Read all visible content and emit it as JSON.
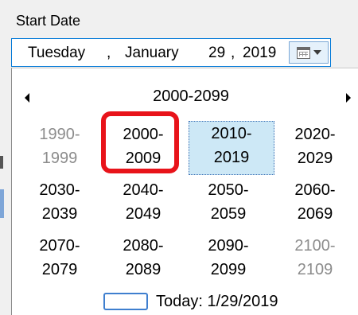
{
  "field": {
    "label": "Start Date",
    "weekday": "Tuesday",
    "separator1": ",",
    "month": "January",
    "day": "29",
    "separator2": ",",
    "year": "2019",
    "button_icon": "calendar-dropdown-icon"
  },
  "calendar": {
    "view": "century",
    "header": "2000-2099",
    "prev_icon": "triangle-left-icon",
    "next_icon": "triangle-right-icon",
    "rows": [
      [
        {
          "start": "1990-",
          "end": "1999",
          "out_of_range": true
        },
        {
          "start": "2000-",
          "end": "2009",
          "out_of_range": false
        },
        {
          "start": "2010-",
          "end": "2019",
          "out_of_range": false,
          "selected": true
        },
        {
          "start": "2020-",
          "end": "2029",
          "out_of_range": false
        }
      ],
      [
        {
          "start": "2030-",
          "end": "2039",
          "out_of_range": false
        },
        {
          "start": "2040-",
          "end": "2049",
          "out_of_range": false
        },
        {
          "start": "2050-",
          "end": "2059",
          "out_of_range": false
        },
        {
          "start": "2060-",
          "end": "2069",
          "out_of_range": false
        }
      ],
      [
        {
          "start": "2070-",
          "end": "2079",
          "out_of_range": false
        },
        {
          "start": "2080-",
          "end": "2089",
          "out_of_range": false
        },
        {
          "start": "2090-",
          "end": "2099",
          "out_of_range": false
        },
        {
          "start": "2100-",
          "end": "2109",
          "out_of_range": true
        }
      ]
    ],
    "today_label": "Today: 1/29/2019"
  },
  "annotation": {
    "highlight_color": "#e8131a",
    "highlighted_cell": "2000-2009"
  },
  "colors": {
    "accent": "#0078d7",
    "selection_fill": "#cde8f6",
    "dimmed_text": "#8c8c8c"
  }
}
